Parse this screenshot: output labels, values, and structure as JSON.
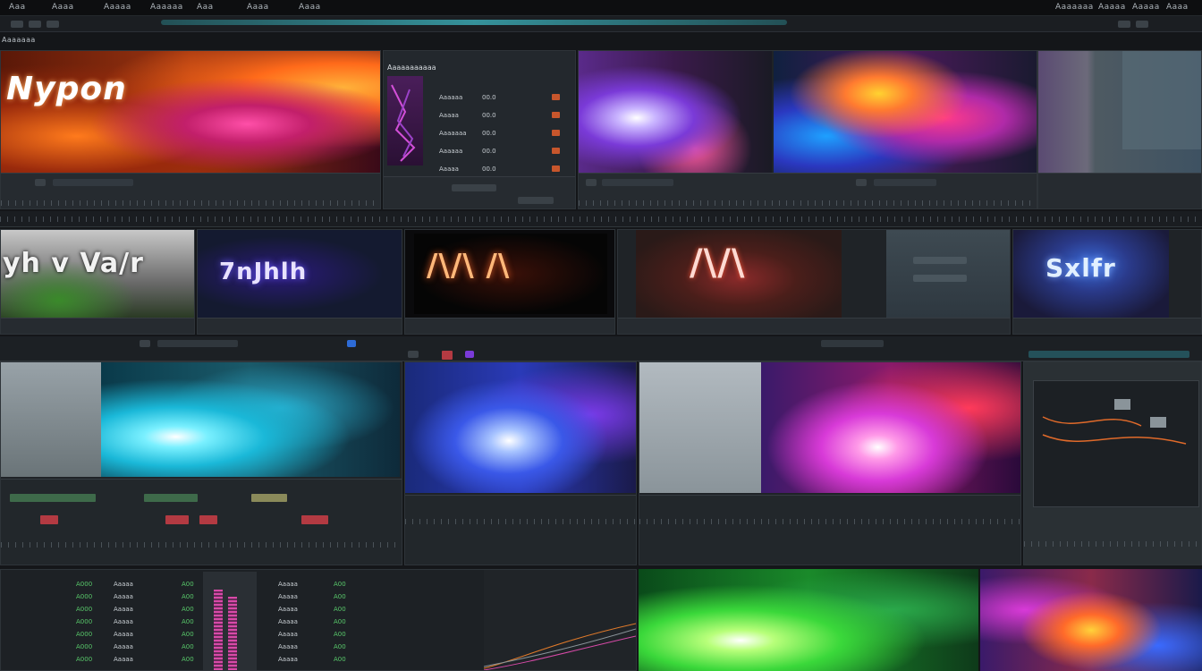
{
  "menu": [
    "Aaa",
    "Aaaa",
    "Aaaaa",
    "Aaaaaa",
    "Aaa",
    "Aaaa",
    "Aaaa"
  ],
  "menu_right": [
    "Aaaaaaa",
    "Aaaaa",
    "Aaaaa",
    "Aaaa"
  ],
  "section_label": "Aaaaaaa",
  "row1": {
    "clip1": {
      "title": "Nypon"
    },
    "effects_panel": {
      "title": "Aaaaaaaaaaa",
      "params": [
        {
          "label": "Aaaaaa",
          "value": "00.0"
        },
        {
          "label": "Aaaaa",
          "value": "00.0"
        },
        {
          "label": "Aaaaaaa",
          "value": "00.0"
        },
        {
          "label": "Aaaaaa",
          "value": "00.0"
        },
        {
          "label": "Aaaaa",
          "value": "00.0"
        }
      ]
    }
  },
  "row2": {
    "clip1": {
      "title": "yh v Va/r"
    },
    "clip2": {
      "title": "7nJhlh"
    },
    "clip3": {
      "title": "/\\/\\ /\\"
    },
    "clip4": {
      "title": "/\\/\\"
    },
    "clip5": {
      "title": "Sxlfr"
    }
  },
  "bottom_list": {
    "col1": [
      "A000",
      "A000",
      "A000",
      "A000",
      "A000",
      "A000",
      "A000"
    ],
    "col2": [
      "Aaaaa",
      "Aaaaa",
      "Aaaaa",
      "Aaaaa",
      "Aaaaa",
      "Aaaaa",
      "Aaaaa"
    ],
    "col3": [
      "A00",
      "A00",
      "A00",
      "A00",
      "A00",
      "A00",
      "A00"
    ],
    "col4": [
      "Aaaaa",
      "Aaaaa",
      "Aaaaa",
      "Aaaaa",
      "Aaaaa",
      "Aaaaa",
      "Aaaaa"
    ],
    "col5": [
      "A00",
      "A00",
      "A00",
      "A00",
      "A00",
      "A00",
      "A00"
    ]
  },
  "colors": {
    "accent": "#3aa6b0",
    "numbers": "#58c86a",
    "record": "#b33a42",
    "select": "#2d6bd6"
  }
}
